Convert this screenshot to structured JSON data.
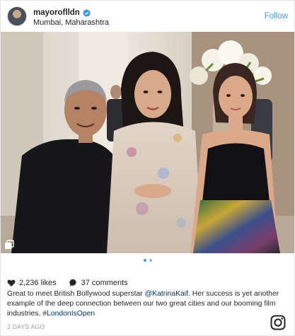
{
  "header": {
    "username": "mayoroflldn",
    "location": "Mumbai, Maharashtra",
    "follow_label": "Follow",
    "avatar_icon": "avatar-photo",
    "verified_icon": "verified-badge-icon"
  },
  "photo": {
    "carousel_icon": "multiple-photos-icon",
    "slide_count": 2,
    "active_slide": 1
  },
  "stats": {
    "likes": "2,236 likes",
    "comments": "37 comments",
    "like_icon": "heart-icon",
    "comment_icon": "comment-bubble-icon"
  },
  "caption": {
    "text_before": "Great to meet British Bollywood superstar ",
    "mention": "@KatrinaKaif",
    "text_after": ". Her success is yet another example of the deep connection between our two great cities and our booming film industries. ",
    "hashtag": "#LondonIsOpen"
  },
  "timestamp": "2 DAYS AGO",
  "brand": {
    "logo_icon": "instagram-logo-icon"
  },
  "colors": {
    "link": "#003569",
    "follow": "#3897f0",
    "text": "#262626",
    "muted": "#999999"
  }
}
